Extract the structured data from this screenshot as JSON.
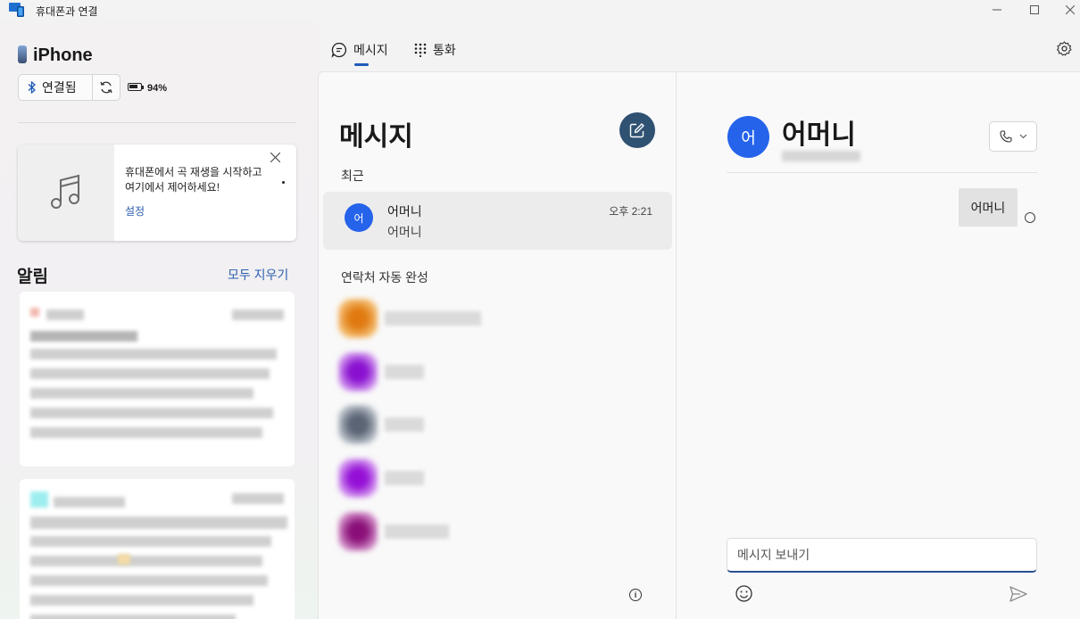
{
  "window": {
    "title": "휴대폰과 연결"
  },
  "device": {
    "name": "iPhone",
    "connection_label": "연결됨",
    "battery": "94%"
  },
  "media_card": {
    "text": "휴대폰에서 곡 재생을 시작하고 여기에서 제어하세요!",
    "link": "설정"
  },
  "notifications": {
    "title": "알림",
    "clear_all": "모두 지우기"
  },
  "tabs": [
    {
      "label": "메시지",
      "icon": "message-icon",
      "active": true
    },
    {
      "label": "통화",
      "icon": "dialpad-icon",
      "active": false
    }
  ],
  "messages_panel": {
    "title": "메시지",
    "recent_label": "최근",
    "conversations": [
      {
        "avatar_initial": "어",
        "name": "어머니",
        "preview": "어머니",
        "time": "오후 2:21"
      }
    ],
    "autocomplete_label": "연락처 자동 완성",
    "contacts": [
      {
        "avatar_color": "#f09a2c"
      },
      {
        "avatar_color": "#9b2bd6"
      },
      {
        "avatar_color": "#6b7480"
      },
      {
        "avatar_color": "#a01ad6"
      },
      {
        "avatar_color": "#9a1d7e"
      }
    ]
  },
  "conversation": {
    "avatar_initial": "어",
    "name": "어머니",
    "messages": [
      {
        "text": "어머니",
        "direction": "outgoing"
      }
    ],
    "input_placeholder": "메시지 보내기"
  },
  "colors": {
    "accent": "#1f5bb8",
    "avatar": "#2563eb",
    "compose": "#2f5172"
  }
}
